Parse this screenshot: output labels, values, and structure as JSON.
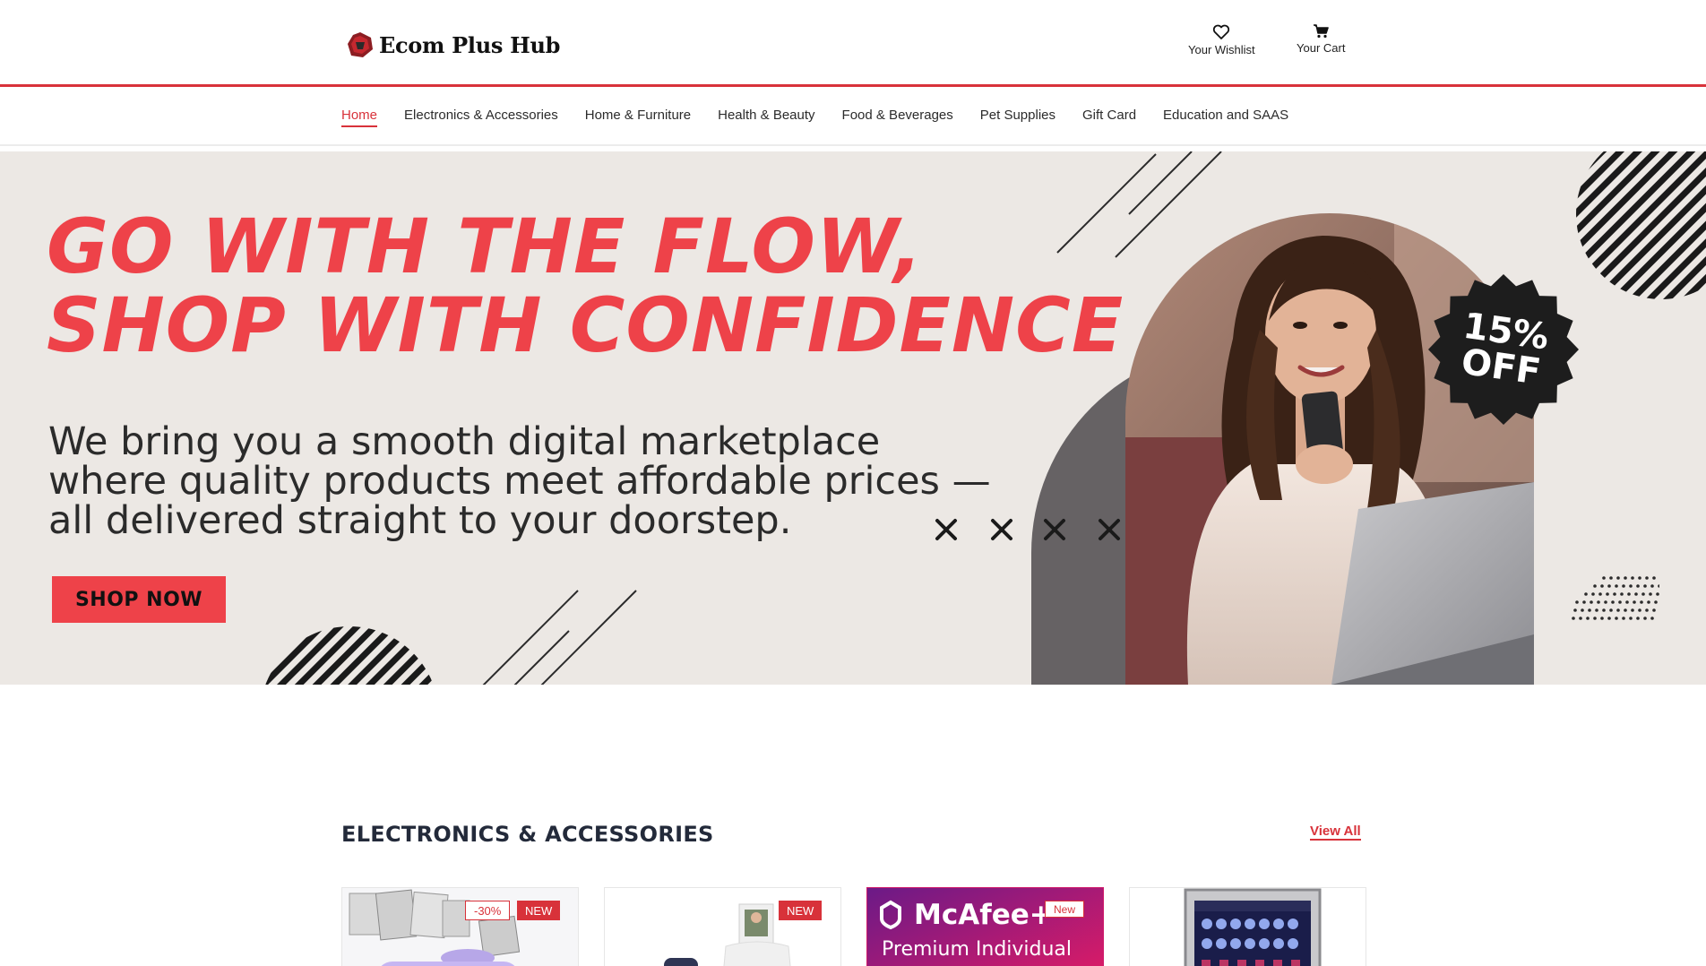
{
  "header": {
    "logo_text": "Ecom Plus Hub",
    "wishlist_label": "Your Wishlist",
    "cart_label": "Your Cart"
  },
  "nav": {
    "items": [
      {
        "label": "Home",
        "active": true
      },
      {
        "label": "Electronics & Accessories"
      },
      {
        "label": "Home & Furniture"
      },
      {
        "label": "Health & Beauty"
      },
      {
        "label": "Food & Beverages"
      },
      {
        "label": "Pet Supplies"
      },
      {
        "label": "Gift Card"
      },
      {
        "label": "Education and SAAS"
      }
    ]
  },
  "hero": {
    "title_line1": "GO WITH THE FLOW,",
    "title_line2": "SHOP WITH CONFIDENCE",
    "subtitle_line1": "We bring you a smooth digital marketplace",
    "subtitle_line2": "where quality products meet affordable prices —",
    "subtitle_line3": "all delivered straight to your doorstep.",
    "button_label": "SHOP NOW",
    "badge_line1": "15%",
    "badge_line2": "OFF"
  },
  "section": {
    "title": "ELECTRONICS & ACCESSORIES",
    "view_all": "View All",
    "products": [
      {
        "tags": [
          "-30%",
          "NEW"
        ]
      },
      {
        "tags": [
          "NEW"
        ]
      },
      {
        "tags": [
          "New"
        ],
        "brand_text": "McAfee+",
        "plan_text": "Premium Individual"
      },
      {
        "tags": []
      }
    ]
  },
  "colors": {
    "accent": "#d8323a",
    "hero_red": "#ee4249",
    "hero_bg": "#ece8e4",
    "dark": "#232a3a"
  }
}
